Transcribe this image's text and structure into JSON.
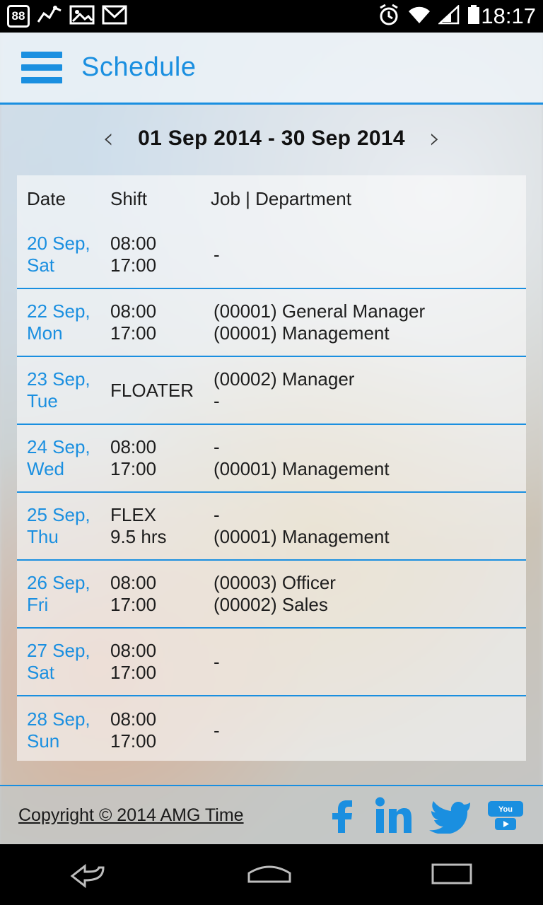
{
  "statusbar": {
    "left_icons": [
      "notification-badge-icon",
      "signal-chart-icon",
      "image-icon",
      "gmail-icon"
    ],
    "badge_count": "88",
    "right_icons": [
      "alarm-icon",
      "wifi-icon",
      "cellular-signal-icon",
      "battery-icon"
    ],
    "time": "18:17"
  },
  "header": {
    "menu_icon": "hamburger-menu-icon",
    "title": "Schedule",
    "accent_color": "#1a8fe0"
  },
  "datenav": {
    "prev_label": "‹",
    "next_label": "›",
    "range": "01 Sep 2014 - 30 Sep 2014"
  },
  "table": {
    "headers": {
      "date": "Date",
      "shift": "Shift",
      "job": "Job | Department"
    },
    "rows": [
      {
        "date_line1": "20 Sep,",
        "date_line2": "Sat",
        "shift_line1": "08:00",
        "shift_line2": "17:00",
        "job_line1": "-",
        "job_line2": ""
      },
      {
        "date_line1": "22 Sep,",
        "date_line2": "Mon",
        "shift_line1": "08:00",
        "shift_line2": "17:00",
        "job_line1": "(00001) General Manager",
        "job_line2": "(00001) Management"
      },
      {
        "date_line1": "23 Sep,",
        "date_line2": "Tue",
        "shift_line1": "FLOATER",
        "shift_line2": "",
        "job_line1": "(00002) Manager",
        "job_line2": "-"
      },
      {
        "date_line1": "24 Sep,",
        "date_line2": "Wed",
        "shift_line1": "08:00",
        "shift_line2": "17:00",
        "job_line1": "-",
        "job_line2": "(00001) Management"
      },
      {
        "date_line1": "25 Sep,",
        "date_line2": "Thu",
        "shift_line1": "FLEX",
        "shift_line2": "9.5 hrs",
        "job_line1": "-",
        "job_line2": "(00001) Management"
      },
      {
        "date_line1": "26 Sep,",
        "date_line2": "Fri",
        "shift_line1": "08:00",
        "shift_line2": "17:00",
        "job_line1": "(00003) Officer",
        "job_line2": "(00002) Sales"
      },
      {
        "date_line1": "27 Sep,",
        "date_line2": "Sat",
        "shift_line1": "08:00",
        "shift_line2": "17:00",
        "job_line1": "-",
        "job_line2": ""
      },
      {
        "date_line1": "28 Sep,",
        "date_line2": "Sun",
        "shift_line1": "08:00",
        "shift_line2": "17:00",
        "job_line1": "-",
        "job_line2": ""
      }
    ]
  },
  "footer": {
    "copyright": "Copyright © 2014 AMG Time",
    "social": [
      "facebook-icon",
      "linkedin-icon",
      "twitter-icon",
      "youtube-icon"
    ]
  },
  "navbar": {
    "back": "back-nav-icon",
    "home": "home-nav-icon",
    "recents": "recents-nav-icon"
  }
}
